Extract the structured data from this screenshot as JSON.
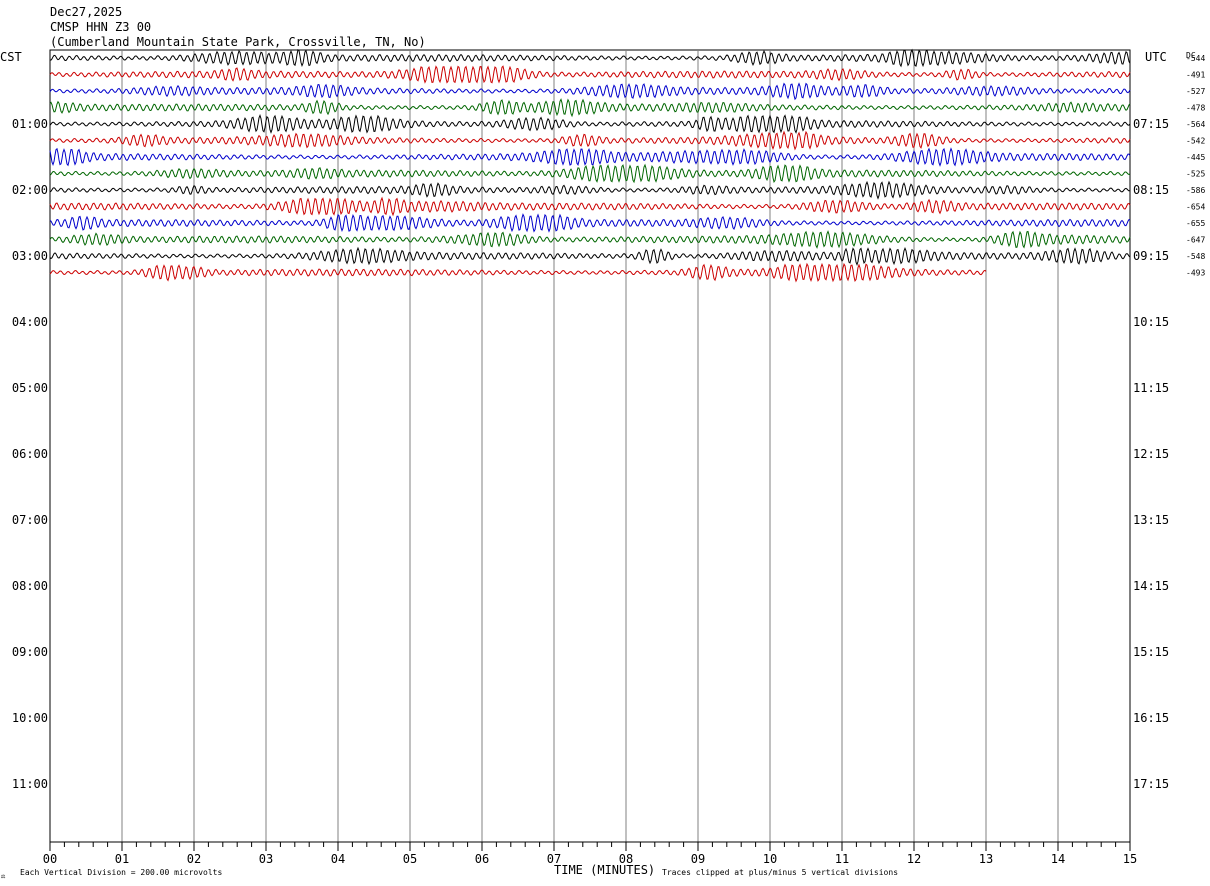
{
  "header": {
    "date": "Dec27,2025",
    "station": "CMSP HHN Z3 00",
    "location": "(Cumberland Mountain State Park, Crossville, TN, No)"
  },
  "left_tz": "CST",
  "right_tz": "UTC",
  "dc_label": "DC",
  "footer": {
    "scale_note": "Each Vertical Division =  200.00 microvolts",
    "clip_note": "Traces clipped at plus/minus 5 vertical divisions",
    "corner_mark": "⚖"
  },
  "chart_data": {
    "type": "line",
    "xlabel": "TIME (MINUTES)",
    "xlim": [
      0,
      15
    ],
    "x_ticks": [
      "00",
      "01",
      "02",
      "03",
      "04",
      "05",
      "06",
      "07",
      "08",
      "09",
      "10",
      "11",
      "12",
      "13",
      "14",
      "15"
    ],
    "rows_per_hour": 4,
    "hour_labels_cst": [
      "01:00",
      "02:00",
      "03:00",
      "04:00",
      "05:00",
      "06:00",
      "07:00",
      "08:00",
      "09:00",
      "10:00",
      "11:00"
    ],
    "hour_labels_utc": [
      "07:15",
      "08:15",
      "09:15",
      "10:15",
      "11:15",
      "12:15",
      "13:15",
      "14:15",
      "15:15",
      "16:15",
      "17:15"
    ],
    "trace_colors": [
      "#000000",
      "#cc0000",
      "#0000cc",
      "#006600"
    ],
    "traces": [
      {
        "dc": -544,
        "color": "#000000",
        "duration_min": 15
      },
      {
        "dc": -491,
        "color": "#cc0000",
        "duration_min": 15
      },
      {
        "dc": -527,
        "color": "#0000cc",
        "duration_min": 15
      },
      {
        "dc": -478,
        "color": "#006600",
        "duration_min": 15
      },
      {
        "dc": -564,
        "color": "#000000",
        "duration_min": 15
      },
      {
        "dc": -542,
        "color": "#cc0000",
        "duration_min": 15
      },
      {
        "dc": -445,
        "color": "#0000cc",
        "duration_min": 15
      },
      {
        "dc": -525,
        "color": "#006600",
        "duration_min": 15
      },
      {
        "dc": -586,
        "color": "#000000",
        "duration_min": 15
      },
      {
        "dc": -654,
        "color": "#cc0000",
        "duration_min": 15
      },
      {
        "dc": -655,
        "color": "#0000cc",
        "duration_min": 15
      },
      {
        "dc": -647,
        "color": "#006600",
        "duration_min": 15
      },
      {
        "dc": -548,
        "color": "#000000",
        "duration_min": 15
      },
      {
        "dc": -493,
        "color": "#cc0000",
        "duration_min": 13
      }
    ]
  }
}
